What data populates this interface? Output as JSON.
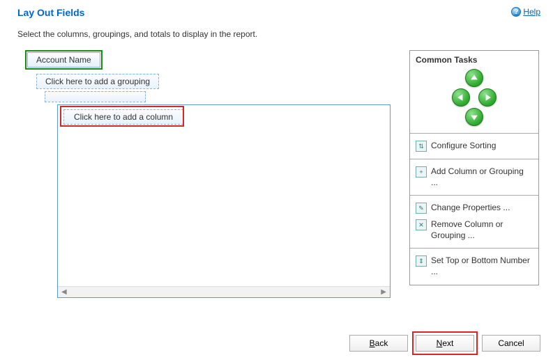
{
  "header": {
    "title": "Lay Out Fields",
    "help_label": "Help"
  },
  "subtitle": "Select the columns, groupings, and totals to display in the report.",
  "layout": {
    "primary_group": "Account Name",
    "add_grouping_hint": "Click here to add a grouping",
    "add_column_hint": "Click here to add a column"
  },
  "sidebar": {
    "title": "Common Tasks",
    "tasks": {
      "configure_sorting": "Configure Sorting",
      "add_column": "Add Column or Grouping ...",
      "change_props": "Change Properties ...",
      "remove_column": "Remove Column or Grouping ...",
      "set_topn": "Set Top or Bottom Number ..."
    }
  },
  "footer": {
    "back": "Back",
    "next": "Next",
    "cancel": "Cancel"
  }
}
